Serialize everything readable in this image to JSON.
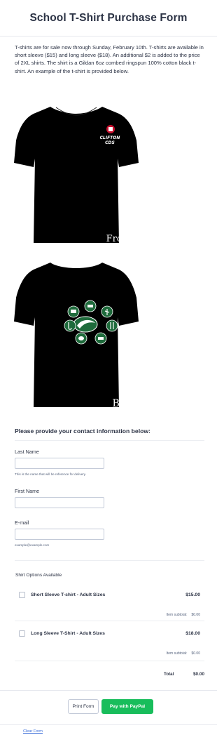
{
  "header": {
    "title": "School T-Shirt Purchase Form"
  },
  "intro": {
    "text": "T-shirts are for sale now through Sunday, February 10th.  T-shirts are available in short sleeve ($15) and long sleeve ($18).  An additional $2 is added to the price of 2XL shirts.  The shirt is a Gildan 6oz combed ringspun 100% cotton black t-shirt.  An example of the t-shirt is provided below."
  },
  "images": {
    "front": {
      "logo_line1": "CLIFTON",
      "logo_line2": "CDS",
      "caption": "Front"
    },
    "back": {
      "caption": "Back"
    }
  },
  "contact": {
    "heading": "Please provide your contact information below:",
    "last_name": {
      "label": "Last Name",
      "value": "",
      "hint": "This is the name that will be reference for delivery."
    },
    "first_name": {
      "label": "First Name",
      "value": ""
    },
    "email": {
      "label": "E-mail",
      "value": "",
      "hint": "example@example.com"
    }
  },
  "options": {
    "heading": "Shirt Options Available",
    "products": [
      {
        "name": "Short Sleeve T-shirt - Adult Sizes",
        "price": "$15.00",
        "subtotal_label": "Item subtotal:",
        "subtotal": "$0.00"
      },
      {
        "name": "Long Sleeve T-Shirt - Adult Sizes",
        "price": "$18.00",
        "subtotal_label": "Item subtotal:",
        "subtotal": "$0.00"
      }
    ],
    "total_label": "Total",
    "total": "$0.00"
  },
  "footer": {
    "print_label": "Print Form",
    "paypal_label": "Pay with PayPal",
    "clear_label": "Clear Form"
  },
  "colors": {
    "paypal_button": "#18bd5b",
    "link": "#3d6fd9",
    "text": "#2c3345",
    "shirt": "#000000",
    "icon_circle": "#1f6b3c"
  }
}
